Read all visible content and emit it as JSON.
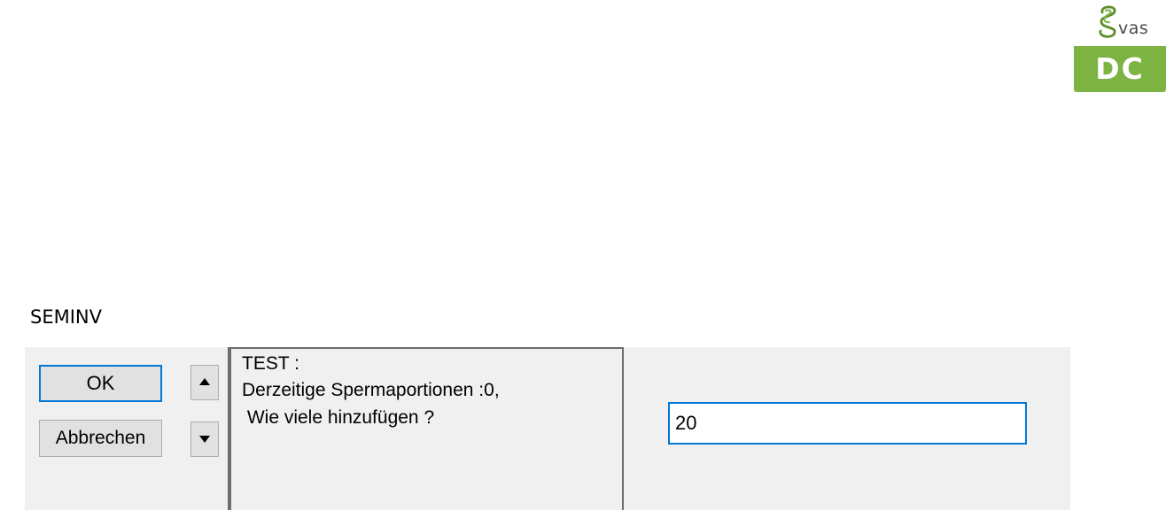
{
  "logo": {
    "brand_small": "vas",
    "brand_large": "DC",
    "colors": {
      "green": "#7cb342",
      "text_dark": "#4a4a4a"
    }
  },
  "dialog": {
    "title": "SEMINV",
    "buttons": {
      "ok_label": "OK",
      "cancel_label": "Abbrechen"
    },
    "spinner": {
      "up_icon": "triangle-up-icon",
      "down_icon": "triangle-down-icon"
    },
    "message": {
      "line1": "TEST :",
      "line2": "Derzeitige Spermaportionen :0,",
      "line3": " Wie viele hinzufügen ?"
    },
    "input": {
      "value": "20"
    },
    "colors": {
      "focus_border": "#0078d7",
      "panel_bg": "#f0f0f0",
      "button_bg": "#e1e1e1"
    }
  }
}
